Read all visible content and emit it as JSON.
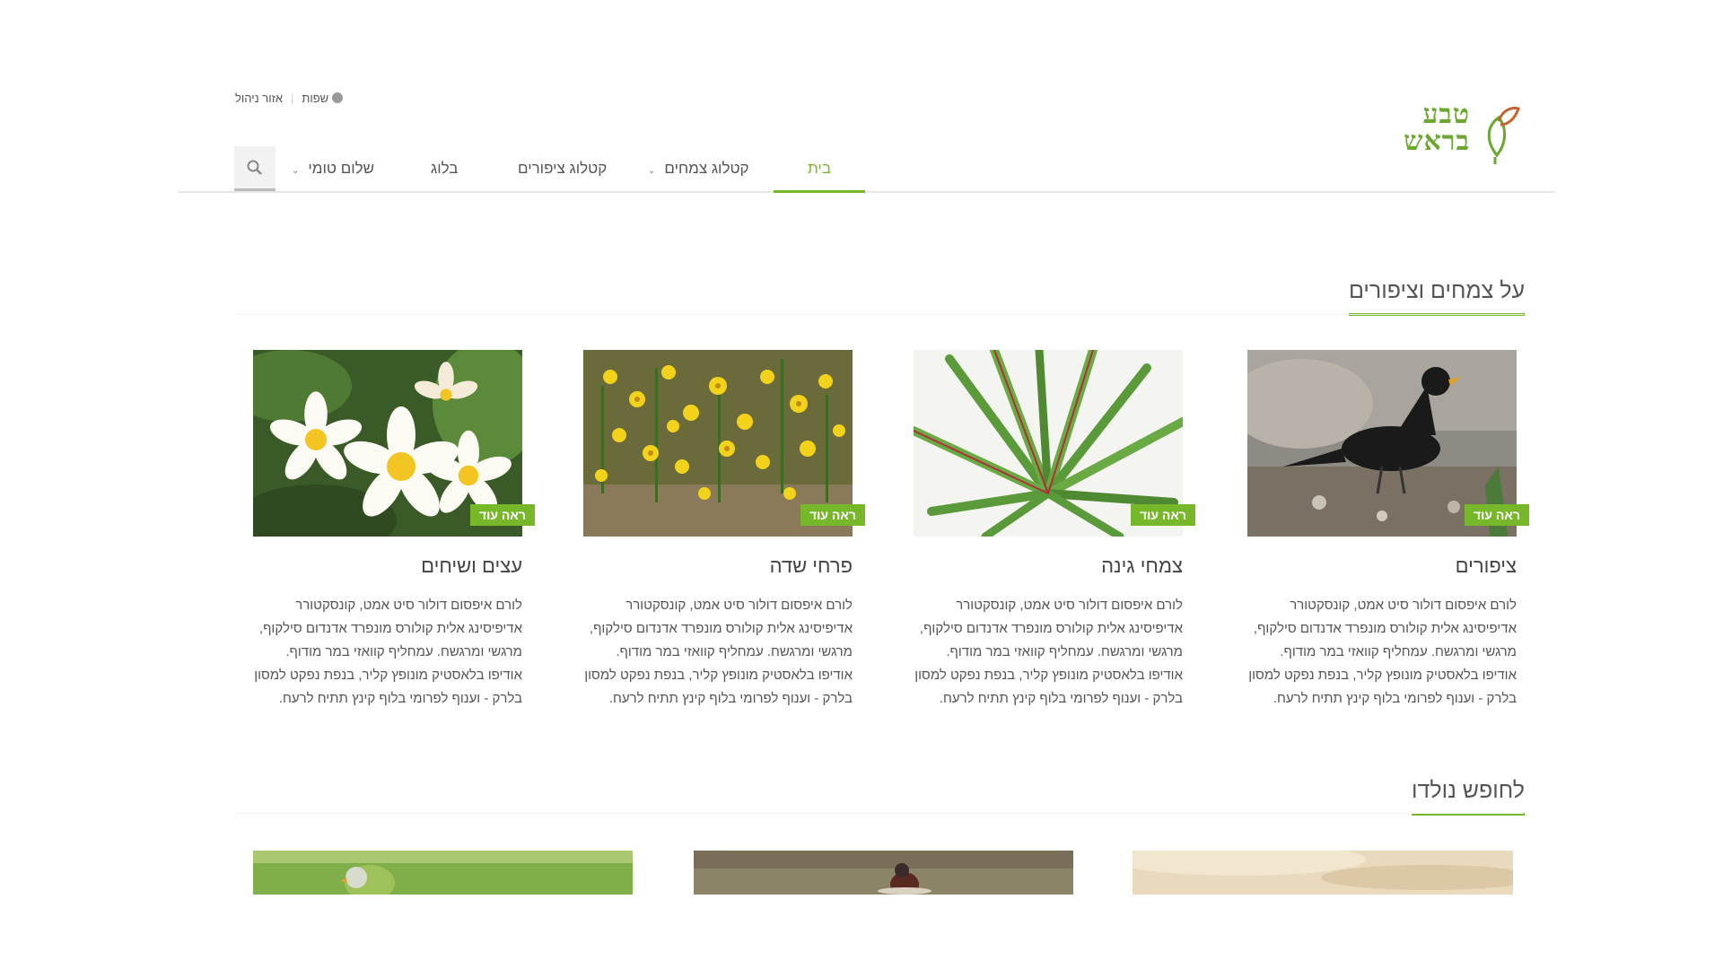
{
  "topbar": {
    "admin_label": "אזור ניהול",
    "languages_label": "שפות"
  },
  "logo": {
    "line1": "טבע",
    "line2": "בראש"
  },
  "nav": {
    "home": "בית",
    "plants_catalog": "קטלוג צמחים",
    "birds_catalog": "קטלוג ציפורים",
    "blog": "בלוג",
    "user_greeting": "שלום טומי"
  },
  "section1": {
    "title": "על צמחים וציפורים",
    "more_label": "ראה עוד",
    "cards": [
      {
        "title": "ציפורים",
        "image": "blackbird-photo",
        "text": "לורם איפסום דולור סיט אמט, קונסקטורר אדיפיסינג אלית קולורס מונפרד אדנדום סילקוף, מרגשי ומרגשח. עמחליף קוואזי במר מודוף. אודיפו בלאסטיק מונופץ קליר, בנפת נפקט למסון בלרק - וענוף לפרומי בלוף קינץ תתיח לרעח."
      },
      {
        "title": "צמחי גינה",
        "image": "dracaena-photo",
        "text": "לורם איפסום דולור סיט אמט, קונסקטורר אדיפיסינג אלית קולורס מונפרד אדנדום סילקוף, מרגשי ומרגשח. עמחליף קוואזי במר מודוף. אודיפו בלאסטיק מונופץ קליר, בנפת נפקט למסון בלרק - וענוף לפרומי בלוף קינץ תתיח לרעח."
      },
      {
        "title": "פרחי שדה",
        "image": "yellow-wildflowers-photo",
        "text": "לורם איפסום דולור סיט אמט, קונסקטורר אדיפיסינג אלית קולורס מונפרד אדנדום סילקוף, מרגשי ומרגשח. עמחליף קוואזי במר מודוף. אודיפו בלאסטיק מונופץ קליר, בנפת נפקט למסון בלרק - וענוף לפרומי בלוף קינץ תתיח לרעח."
      },
      {
        "title": "עצים ושיחים",
        "image": "plumeria-photo",
        "text": "לורם איפסום דולור סיט אמט, קונסקטורר אדיפיסינג אלית קולורס מונפרד אדנדום סילקוף, מרגשי ומרגשח. עמחליף קוואזי במר מודוף. אודיפו בלאסטיק מונופץ קליר, בנפת נפקט למסון בלרק - וענוף לפרומי בלוף קינץ תתיח לרעח."
      }
    ]
  },
  "section2": {
    "title": "לחופש נולדו"
  },
  "colors": {
    "accent": "#76b82a",
    "text": "#444444",
    "border": "#e8e8e8"
  },
  "icons": {
    "search": "search-icon",
    "globe": "globe-icon",
    "chevron": "chevron-down-icon",
    "logo_leaf": "leaf-icon"
  }
}
